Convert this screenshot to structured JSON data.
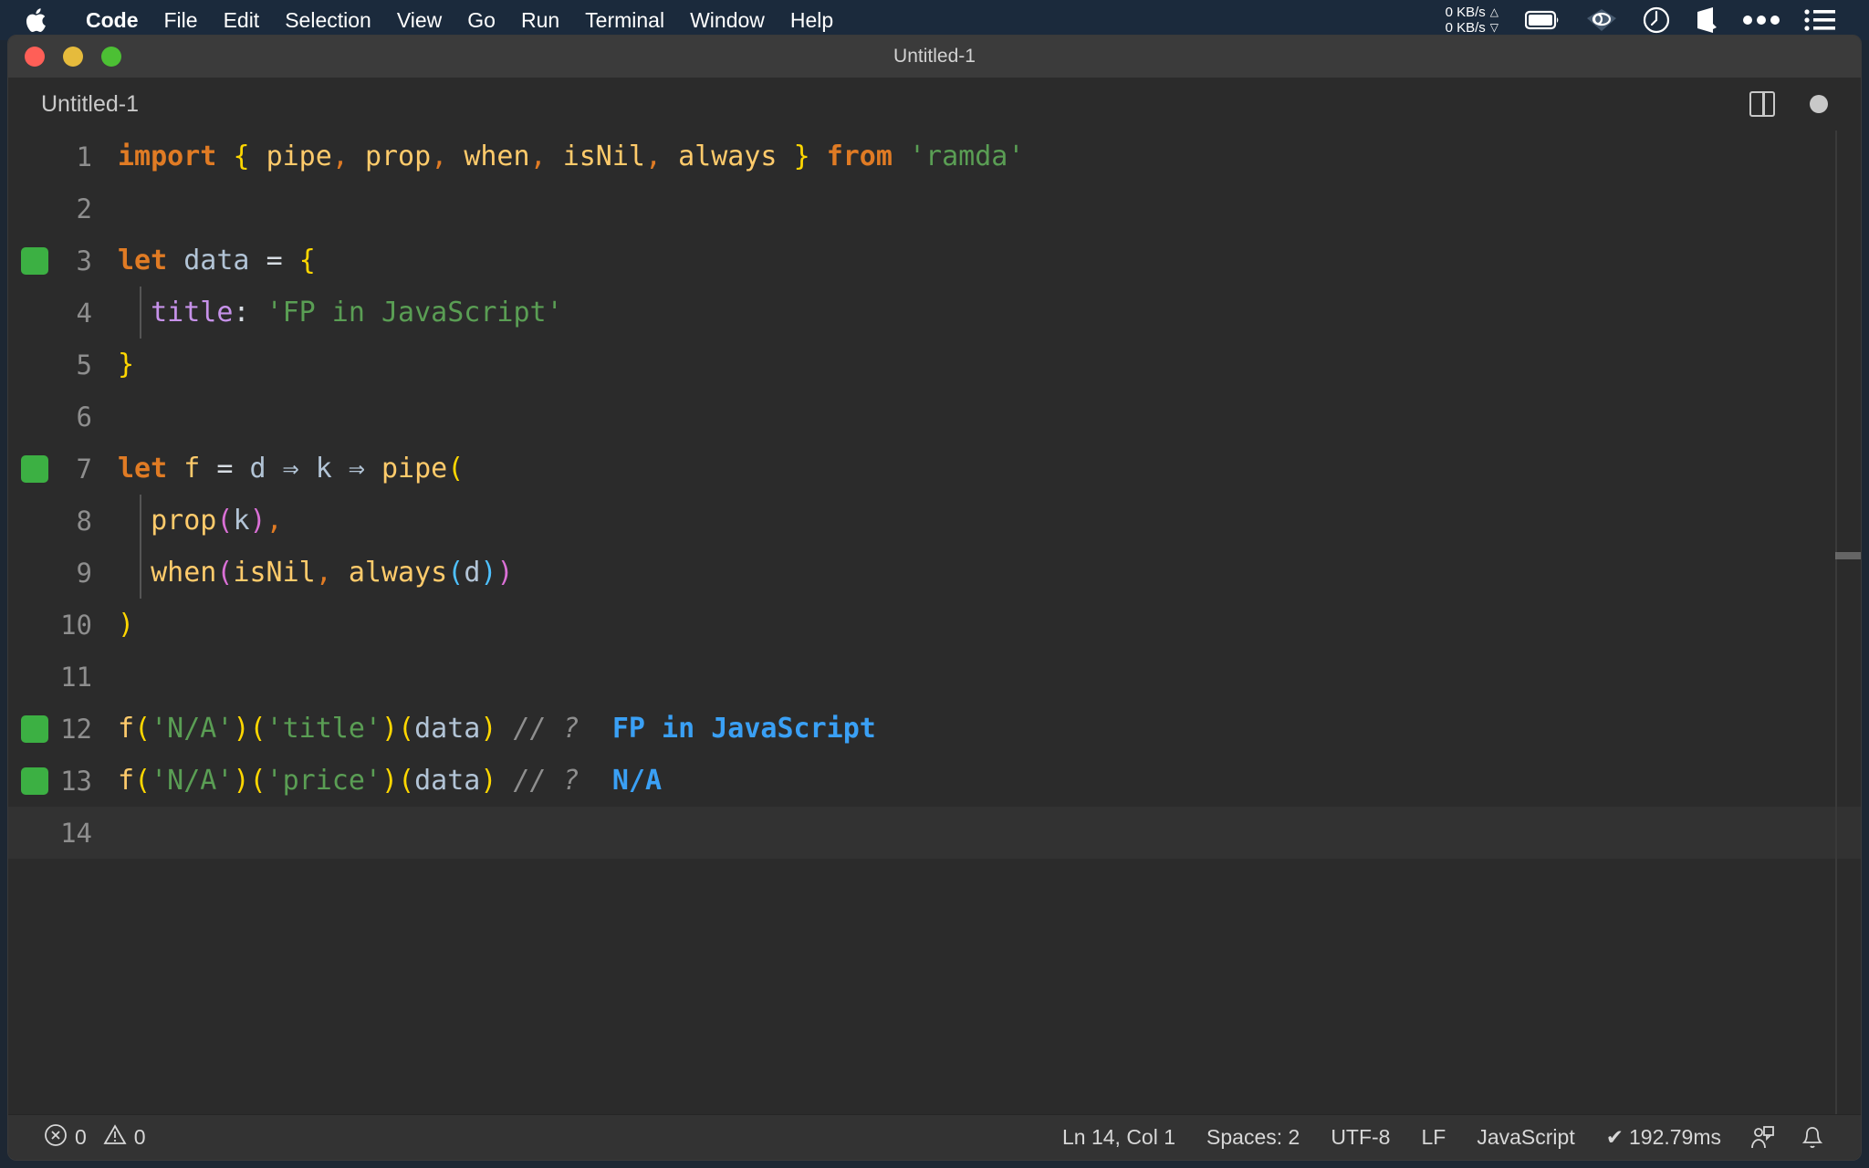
{
  "menubar": {
    "apple_icon": "apple-logo-icon",
    "items": [
      {
        "label": "Code",
        "bold": true
      },
      {
        "label": "File",
        "bold": false
      },
      {
        "label": "Edit",
        "bold": false
      },
      {
        "label": "Selection",
        "bold": false
      },
      {
        "label": "View",
        "bold": false
      },
      {
        "label": "Go",
        "bold": false
      },
      {
        "label": "Run",
        "bold": false
      },
      {
        "label": "Terminal",
        "bold": false
      },
      {
        "label": "Window",
        "bold": false
      },
      {
        "label": "Help",
        "bold": false
      }
    ],
    "network_up": "0 KB/s",
    "network_down": "0 KB/s",
    "up_arrow": "△",
    "down_arrow": "▽",
    "status_icons": [
      "battery-icon",
      "wifi-cloud-icon",
      "clock-icon",
      "cube-icon",
      "ellipsis-icon",
      "list-icon"
    ]
  },
  "window": {
    "title": "Untitled-1",
    "traffic_lights": [
      "close-button",
      "minimize-button",
      "zoom-button"
    ]
  },
  "tabs": {
    "active": "Untitled-1",
    "items": [
      {
        "label": "Untitled-1",
        "dirty": true
      }
    ],
    "actions": [
      "split-editor-icon",
      "unsaved-indicator-dot"
    ]
  },
  "editor": {
    "language": "JavaScript",
    "current_line": 14,
    "lines": [
      {
        "n": "1",
        "covered": false,
        "indent_guides": 0
      },
      {
        "n": "2",
        "covered": false,
        "indent_guides": 0
      },
      {
        "n": "3",
        "covered": true,
        "indent_guides": 0
      },
      {
        "n": "4",
        "covered": false,
        "indent_guides": 1
      },
      {
        "n": "5",
        "covered": false,
        "indent_guides": 0
      },
      {
        "n": "6",
        "covered": false,
        "indent_guides": 0
      },
      {
        "n": "7",
        "covered": true,
        "indent_guides": 0
      },
      {
        "n": "8",
        "covered": false,
        "indent_guides": 1
      },
      {
        "n": "9",
        "covered": false,
        "indent_guides": 1
      },
      {
        "n": "10",
        "covered": false,
        "indent_guides": 0
      },
      {
        "n": "11",
        "covered": false,
        "indent_guides": 0
      },
      {
        "n": "12",
        "covered": true,
        "indent_guides": 0
      },
      {
        "n": "13",
        "covered": true,
        "indent_guides": 0
      },
      {
        "n": "14",
        "covered": false,
        "indent_guides": 0
      }
    ],
    "source_text": [
      "import { pipe, prop, when, isNil, always } from 'ramda'",
      "",
      "let data = {",
      "  title: 'FP in JavaScript'",
      "}",
      "",
      "let f = d => k => pipe(",
      "  prop(k),",
      "  when(isNil, always(d))",
      ")",
      "",
      "f('N/A')('title')(data) // ? FP in JavaScript",
      "f('N/A')('price')(data) // ? N/A",
      ""
    ],
    "inline_results": [
      {
        "line": 12,
        "value": "FP in JavaScript"
      },
      {
        "line": 13,
        "value": "N/A"
      }
    ]
  },
  "statusbar": {
    "errors_icon": "error-circle-icon",
    "errors": "0",
    "warnings_icon": "warning-triangle-icon",
    "warnings": "0",
    "cursor": "Ln 14, Col 1",
    "indentation": "Spaces: 2",
    "encoding": "UTF-8",
    "eol": "LF",
    "language": "JavaScript",
    "run_check": "✔",
    "run_time": "192.79ms",
    "feedback_icon": "feedback-person-icon",
    "bell_icon": "bell-icon"
  },
  "colors": {
    "menubar_bg": "#1b2a3c",
    "titlebar_bg": "#3b3b3b",
    "editor_bg": "#2b2b2b",
    "statusbar_bg": "#333333",
    "coverage_green": "#3cb043",
    "keyword": "#e07b24",
    "identifier": "#ffcb6b",
    "string": "#5a9e54",
    "property": "#c792ea",
    "variable": "#b2c4d6",
    "comment": "#8e8e8e",
    "quokka_result": "#3aa0f5",
    "bracket_l1": "#ffd700",
    "bracket_l2": "#da70d6",
    "bracket_l3": "#4fc1ff"
  }
}
